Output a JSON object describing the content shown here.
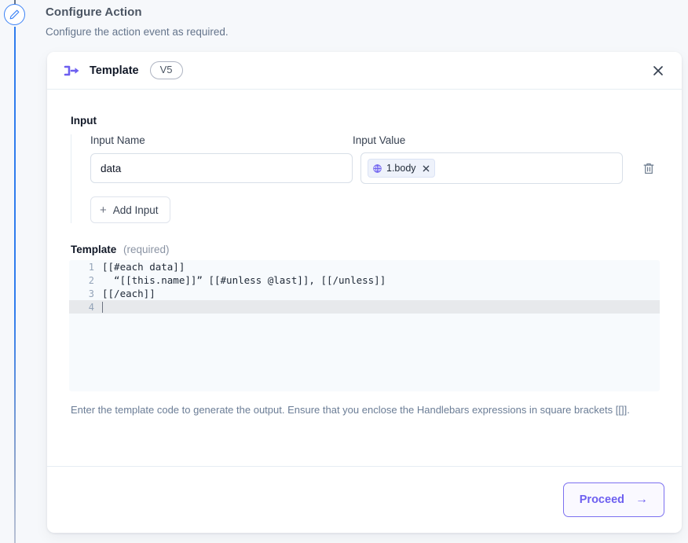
{
  "page": {
    "title": "Configure Action",
    "subtitle": "Configure the action event as required.",
    "step_icon": "pencil-icon"
  },
  "card": {
    "icon": "template-transform-icon",
    "title": "Template",
    "version_badge": "V5",
    "close_icon": "close-icon"
  },
  "input_section": {
    "heading": "Input",
    "name_column_label": "Input Name",
    "value_column_label": "Input Value",
    "name_value": "data",
    "name_placeholder": "Input Name",
    "chip": {
      "icon": "globe-icon",
      "label": "1.body",
      "remove_icon": "close-icon"
    },
    "delete_icon": "trash-icon",
    "add_input_label": "Add Input",
    "add_input_icon": "plus-icon"
  },
  "template_section": {
    "label": "Template",
    "required_note": "(required)",
    "code_lines": [
      {
        "number": "1",
        "text": "[[#each data]]",
        "active": false
      },
      {
        "number": "2",
        "text": "  “[[this.name]]” [[#unless @last]], [[/unless]]",
        "active": false
      },
      {
        "number": "3",
        "text": "[[/each]]",
        "active": false
      },
      {
        "number": "4",
        "text": "",
        "active": true
      }
    ],
    "help_text": "Enter the template code to generate the output. Ensure that you enclose the Handlebars expressions in square brackets [[]]."
  },
  "footer": {
    "proceed_label": "Proceed",
    "proceed_arrow": "→"
  },
  "colors": {
    "accent_purple": "#6d5ff0",
    "rail_blue": "#2f7ced",
    "page_background": "#f6f8fb",
    "card_background": "#ffffff",
    "editor_background": "#f7fafd"
  }
}
